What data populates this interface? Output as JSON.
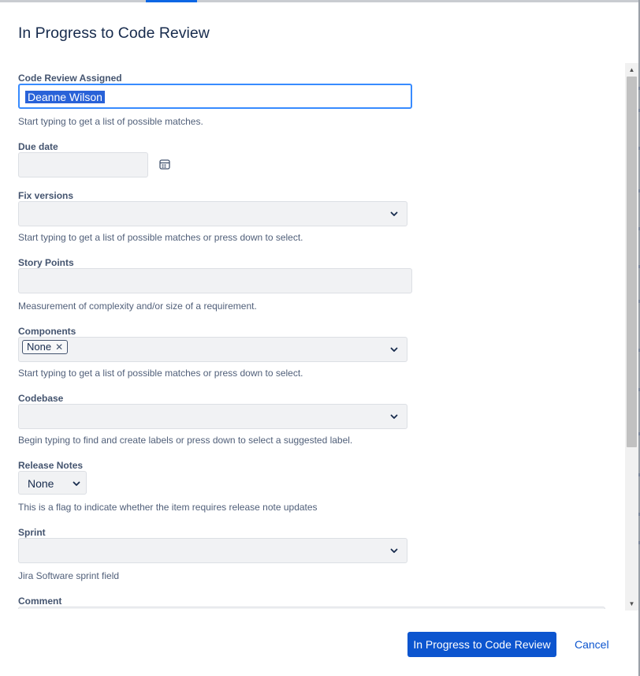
{
  "dialog": {
    "title": "In Progress to Code Review"
  },
  "fields": {
    "code_review_assigned": {
      "label": "Code Review Assigned",
      "value": "Deanne Wilson",
      "help": "Start typing to get a list of possible matches."
    },
    "due_date": {
      "label": "Due date",
      "value": "",
      "icon": "calendar-icon"
    },
    "fix_versions": {
      "label": "Fix versions",
      "value": "",
      "help": "Start typing to get a list of possible matches or press down to select."
    },
    "story_points": {
      "label": "Story Points",
      "value": "",
      "help": "Measurement of complexity and/or size of a requirement."
    },
    "components": {
      "label": "Components",
      "tags": [
        "None"
      ],
      "help": "Start typing to get a list of possible matches or press down to select."
    },
    "codebase": {
      "label": "Codebase",
      "value": "",
      "help": "Begin typing to find and create labels or press down to select a suggested label."
    },
    "release_notes": {
      "label": "Release Notes",
      "value": "None",
      "help": "This is a flag to indicate whether the item requires release note updates"
    },
    "sprint": {
      "label": "Sprint",
      "value": "",
      "help": "Jira Software sprint field"
    },
    "comment": {
      "label": "Comment"
    }
  },
  "footer": {
    "submit_label": "In Progress to Code Review",
    "cancel_label": "Cancel"
  },
  "colors": {
    "primary": "#0c55cf",
    "focus": "#388bff",
    "selection": "#2962d8"
  }
}
